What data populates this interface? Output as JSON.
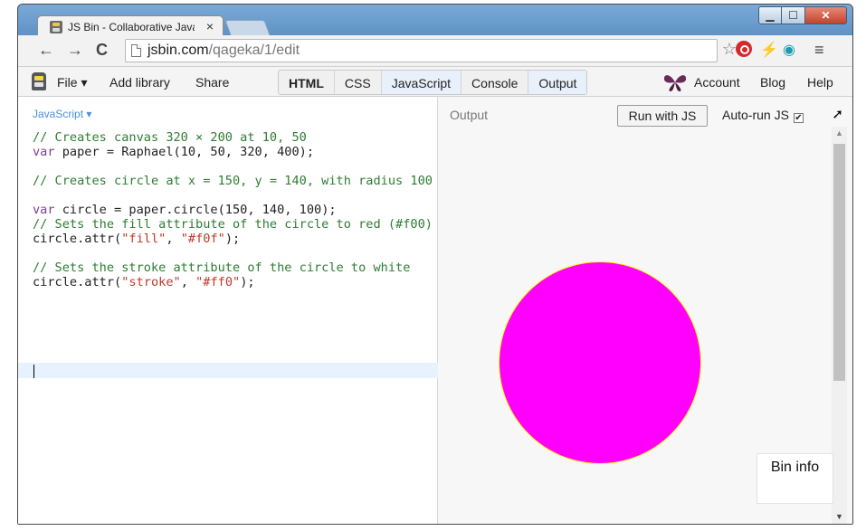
{
  "browser": {
    "tab_title": "JS Bin - Collaborative Java",
    "tab_close": "×",
    "url_host": "jsbin.com",
    "url_path": "/qageka/1/edit"
  },
  "icons": {
    "back": "arrow-left-icon",
    "forward": "arrow-right-icon",
    "reload": "reload-icon",
    "star": "star-icon",
    "menu": "hamburger-menu-icon"
  },
  "jsbin": {
    "file_menu": "File ▾",
    "add_library": "Add library",
    "share": "Share",
    "panels": [
      "HTML",
      "CSS",
      "JavaScript",
      "Console",
      "Output"
    ],
    "account": "Account",
    "blog": "Blog",
    "help": "Help"
  },
  "editor": {
    "panel_label": "JavaScript ▾",
    "code": [
      {
        "t": "// Creates canvas 320 × 200 at 10, 50",
        "k": "c-com"
      },
      {
        "t": "var",
        "k": "c-kw",
        "rest": " paper = Raphael(10, 50, 320, 400);"
      },
      {
        "t": "",
        "k": ""
      },
      {
        "t": "// Creates circle at x = 150, y = 140, with radius 100",
        "k": "c-com"
      },
      {
        "t": "",
        "k": ""
      },
      {
        "t": "var",
        "k": "c-kw",
        "rest": " circle = paper.circle(150, 140, 100);"
      },
      {
        "t": "// Sets the fill attribute of the circle to red (#f00)",
        "k": "c-com"
      },
      {
        "t": "circle.attr(",
        "k": "",
        "str": "\"fill\"",
        "mid": ", ",
        "str2": "\"#f0f\"",
        "end": ");"
      },
      {
        "t": "",
        "k": ""
      },
      {
        "t": "// Sets the stroke attribute of the circle to white",
        "k": "c-com"
      },
      {
        "t": "circle.attr(",
        "k": "",
        "str": "\"stroke\"",
        "mid": ", ",
        "str2": "\"#ff0\"",
        "end": ");"
      }
    ]
  },
  "output": {
    "label": "Output",
    "run_button": "Run with JS",
    "autorun_label": "Auto-run JS",
    "autorun_checked": "✔",
    "bin_info": "Bin info",
    "circle_fill": "#ff00ff",
    "circle_stroke": "#ffff00"
  }
}
